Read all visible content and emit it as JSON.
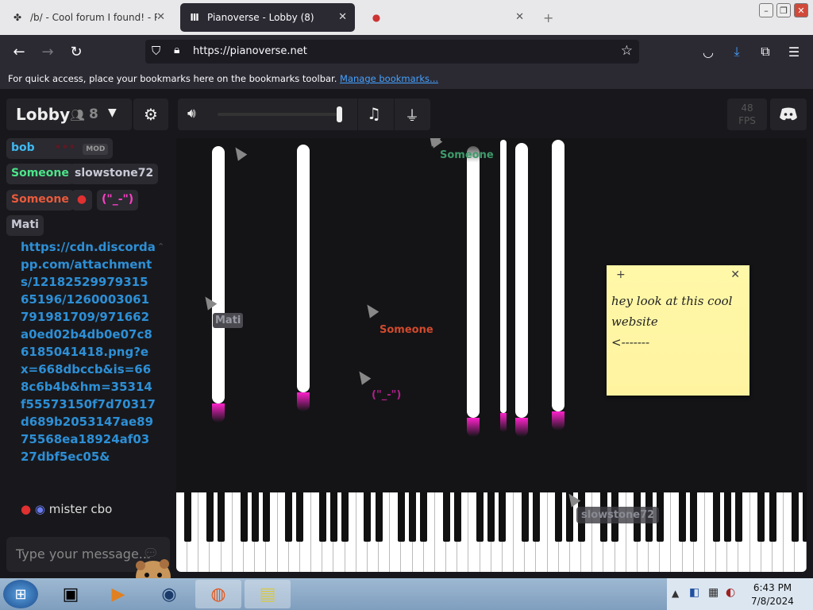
{
  "tabs": [
    {
      "title": "/b/ - Cool forum I found! - Ran",
      "icon": "four-leaf-icon"
    },
    {
      "title": "Pianoverse - Lobby (8)",
      "icon": "pianoverse-logo-icon"
    },
    {
      "title": "",
      "icon": "tab-icon"
    }
  ],
  "url": "https://pianoverse.net",
  "bookmarks": {
    "text": "For quick access, place your bookmarks here on the bookmarks toolbar.",
    "link": "Manage bookmarks..."
  },
  "lobby": {
    "title": "Lobby",
    "count": "8"
  },
  "fps": {
    "value": "48",
    "label": "FPS"
  },
  "users": [
    {
      "name": "bob",
      "color": "#3fb8f0",
      "extra": "•••",
      "badge": "MOD"
    },
    {
      "name": "Someone",
      "color": "#4ce58a"
    },
    {
      "name": "slowstone72",
      "color": "#c9c9d6"
    },
    {
      "name": "Someone",
      "color": "#e85a3c"
    },
    {
      "name": "(\"_-\")",
      "color": "#ff3fc8"
    },
    {
      "name": "Mati",
      "color": "#c9c9d6"
    }
  ],
  "chat": {
    "message": "https://cdn.discordapp.com/attachments/1218252997931565196/1260003061791981709/971662a0ed02b4db0e07c86185041418.png?ex=668dbccb&is=668c6b4b&hm=35314f55573150f7d70317d689b2053147ae8975568ea18924af0327dbf5ec05&",
    "author": "mister cbo",
    "placeholder": "Type your message..."
  },
  "cursors": [
    {
      "label": "Mati",
      "color": "#9a9aa4"
    },
    {
      "label": "Someone",
      "color": "#d04a2e"
    },
    {
      "label": "Someone",
      "color": "#3e9a6a"
    },
    {
      "label": "(\"_-\")",
      "color": "#b0208a"
    },
    {
      "label": "slowstone72",
      "color": "#8a8a94"
    }
  ],
  "sticky_note": {
    "lines": [
      "hey look at this cool",
      "website",
      "<-------"
    ]
  },
  "clock": {
    "time": "6:43 PM",
    "date": "7/8/2024"
  },
  "colors": {
    "accent": "#ff22cc",
    "link": "#2d8fd6"
  }
}
